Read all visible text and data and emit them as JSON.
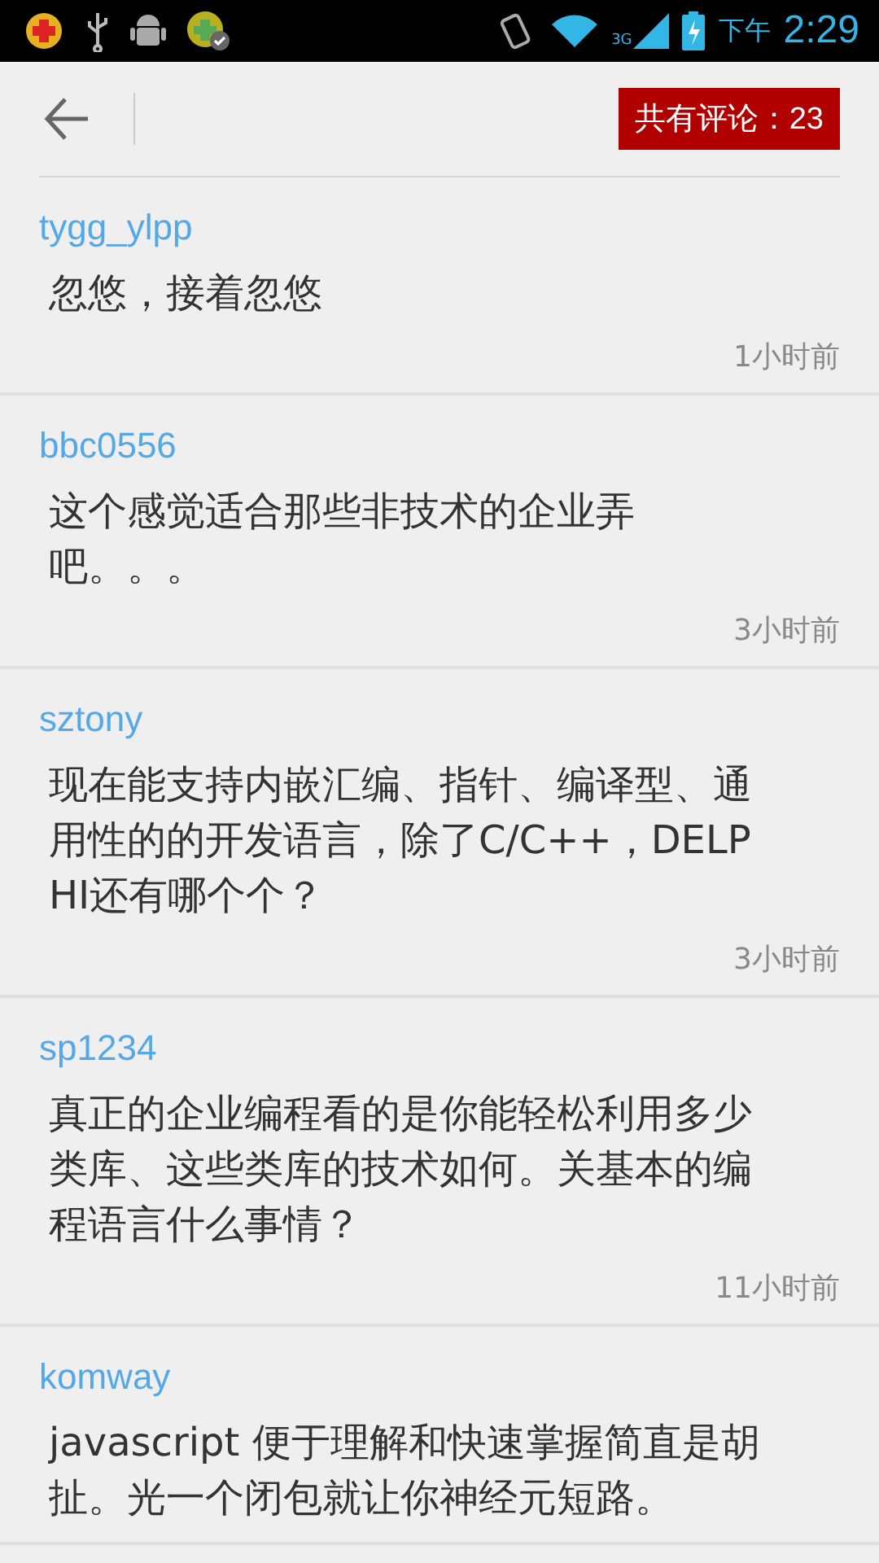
{
  "status_bar": {
    "period": "下午",
    "time": "2:29",
    "network": "3G"
  },
  "header": {
    "comment_count": "共有评论：23"
  },
  "comments": [
    {
      "user": "tygg_ylpp",
      "text": "忽悠，接着忽悠",
      "time": "1小时前"
    },
    {
      "user": "bbc0556",
      "text": "这个感觉适合那些非技术的企业弄吧。。。",
      "time": "3小时前"
    },
    {
      "user": "sztony",
      "text": "现在能支持内嵌汇编、指针、编译型、通用性的的开发语言，除了C/C++，DELPHI还有哪个个？",
      "time": "3小时前"
    },
    {
      "user": "sp1234",
      "text": "真正的企业编程看的是你能轻松利用多少类库、这些类库的技术如何。关基本的编程语言什么事情？",
      "time": "11小时前"
    },
    {
      "user": "komway",
      "text": "javascript 便于理解和快速掌握简直是胡扯。光一个闭包就让你神经元短路。"
    }
  ]
}
